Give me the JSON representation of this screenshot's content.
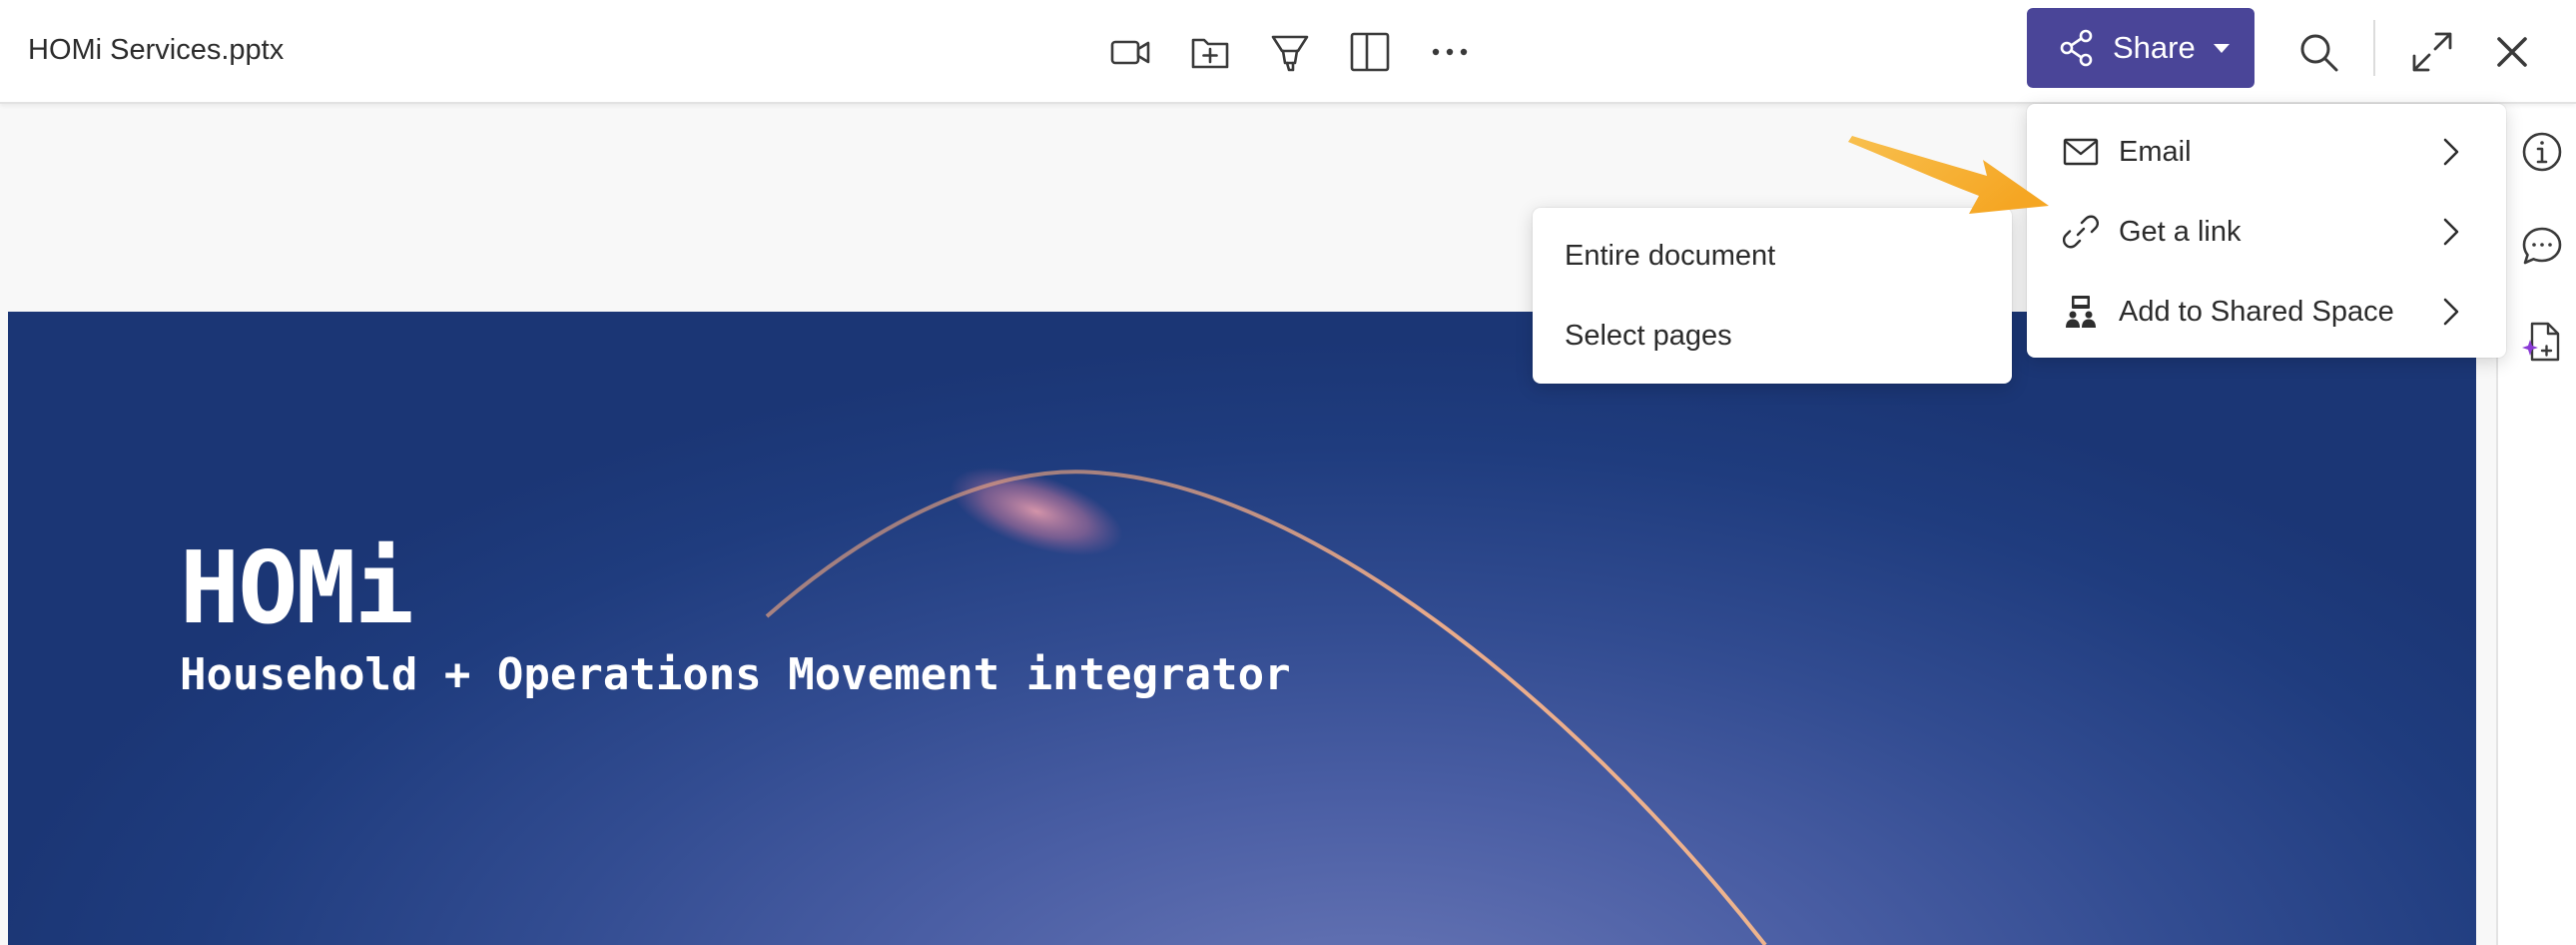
{
  "window": {
    "title": "HOMi Services.pptx"
  },
  "toolbar": {
    "tools": [
      {
        "name": "video",
        "icon": "video-camera-icon"
      },
      {
        "name": "add-to-folder",
        "icon": "folder-plus-icon"
      },
      {
        "name": "highlight",
        "icon": "highlighter-icon"
      },
      {
        "name": "panel",
        "icon": "sidebar-panel-icon"
      },
      {
        "name": "more",
        "icon": "more-horizontal-icon"
      }
    ],
    "share_label": "Share",
    "share_icon": "share-nodes-icon",
    "search_icon": "search-icon",
    "expand_icon": "expand-arrows-icon",
    "close_icon": "close-icon"
  },
  "share_menu": {
    "items": [
      {
        "label": "Email",
        "icon": "envelope-icon"
      },
      {
        "label": "Get a link",
        "icon": "link-icon"
      },
      {
        "label": "Add to Shared Space",
        "icon": "shared-space-icon"
      }
    ]
  },
  "link_submenu": {
    "items": [
      {
        "label": "Entire document"
      },
      {
        "label": "Select pages"
      }
    ]
  },
  "right_rail": {
    "items": [
      {
        "icon": "info-icon"
      },
      {
        "icon": "comment-icon"
      },
      {
        "icon": "ai-document-icon"
      }
    ]
  },
  "slide": {
    "title": "HOMi",
    "subtitle": "Household + Operations Movement integrator"
  },
  "colors": {
    "accent": "#4a4598",
    "annotation_arrow": "#f5a623",
    "slide_background": "#2a4688"
  }
}
